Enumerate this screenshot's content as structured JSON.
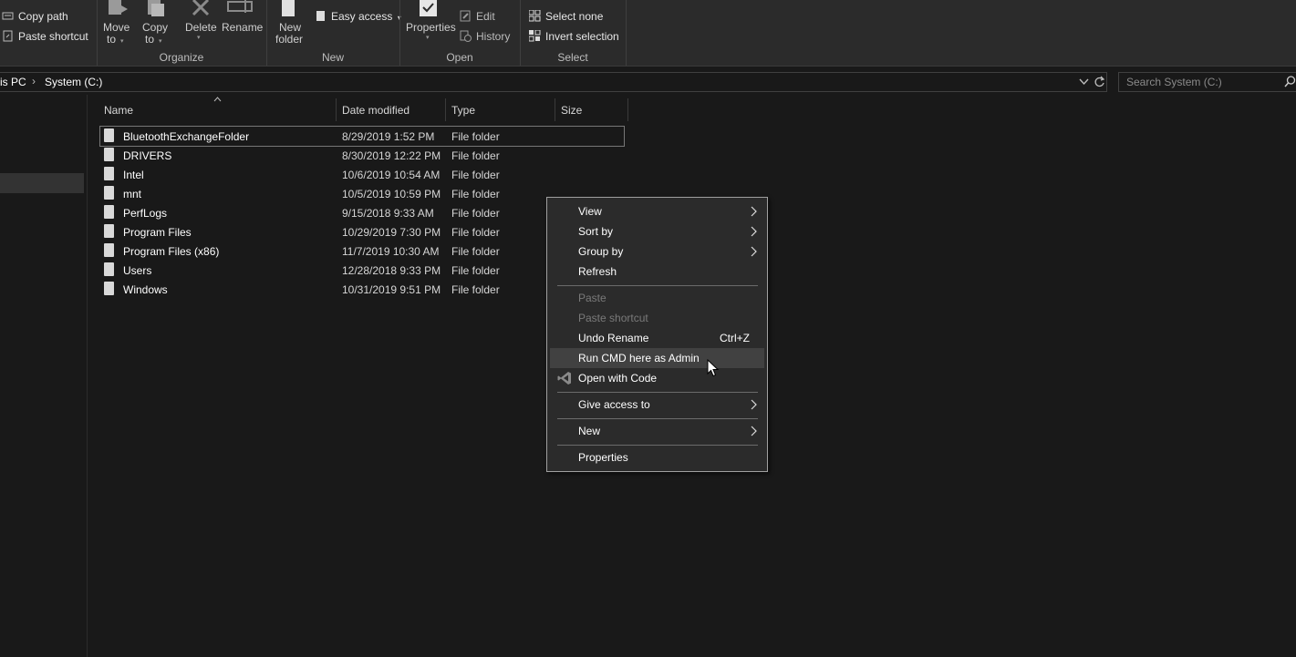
{
  "ribbon": {
    "clipboard": {
      "copy_path": "Copy path",
      "paste_shortcut": "Paste shortcut"
    },
    "organize": {
      "move_to": "Move",
      "move_to_2": "to",
      "copy_to": "Copy",
      "copy_to_2": "to",
      "delete": "Delete",
      "rename": "Rename",
      "label": "Organize"
    },
    "new": {
      "new_folder": "New",
      "new_folder_2": "folder",
      "easy_access": "Easy access",
      "label": "New"
    },
    "open": {
      "properties": "Properties",
      "edit": "Edit",
      "history": "History",
      "label": "Open"
    },
    "select": {
      "select_none": "Select none",
      "invert_selection": "Invert selection",
      "label": "Select"
    }
  },
  "address": {
    "crumb_1": "is PC",
    "crumb_sep": "›",
    "crumb_2": "System (C:)",
    "search_placeholder": "Search System (C:)"
  },
  "columns": {
    "name": "Name",
    "date_modified": "Date modified",
    "type": "Type",
    "size": "Size"
  },
  "files": [
    {
      "name": "BluetoothExchangeFolder",
      "date": "8/29/2019 1:52 PM",
      "type": "File folder"
    },
    {
      "name": "DRIVERS",
      "date": "8/30/2019 12:22 PM",
      "type": "File folder"
    },
    {
      "name": "Intel",
      "date": "10/6/2019 10:54 AM",
      "type": "File folder"
    },
    {
      "name": "mnt",
      "date": "10/5/2019 10:59 PM",
      "type": "File folder"
    },
    {
      "name": "PerfLogs",
      "date": "9/15/2018 9:33 AM",
      "type": "File folder"
    },
    {
      "name": "Program Files",
      "date": "10/29/2019 7:30 PM",
      "type": "File folder"
    },
    {
      "name": "Program Files (x86)",
      "date": "11/7/2019 10:30 AM",
      "type": "File folder"
    },
    {
      "name": "Users",
      "date": "12/28/2018 9:33 PM",
      "type": "File folder"
    },
    {
      "name": "Windows",
      "date": "10/31/2019 9:51 PM",
      "type": "File folder"
    }
  ],
  "context_menu": {
    "view": "View",
    "sort_by": "Sort by",
    "group_by": "Group by",
    "refresh": "Refresh",
    "paste": "Paste",
    "paste_shortcut": "Paste shortcut",
    "undo_rename": "Undo Rename",
    "undo_shortcut": "Ctrl+Z",
    "run_cmd": "Run CMD here as Admin",
    "open_with_code": "Open with Code",
    "give_access": "Give access to",
    "new": "New",
    "properties": "Properties"
  },
  "colors": {
    "background": "#191919",
    "ribbon": "#2b2b2b",
    "menu": "#2b2b2b",
    "menu_hover": "#414141",
    "vscode_icon": "#8a8a8a"
  }
}
